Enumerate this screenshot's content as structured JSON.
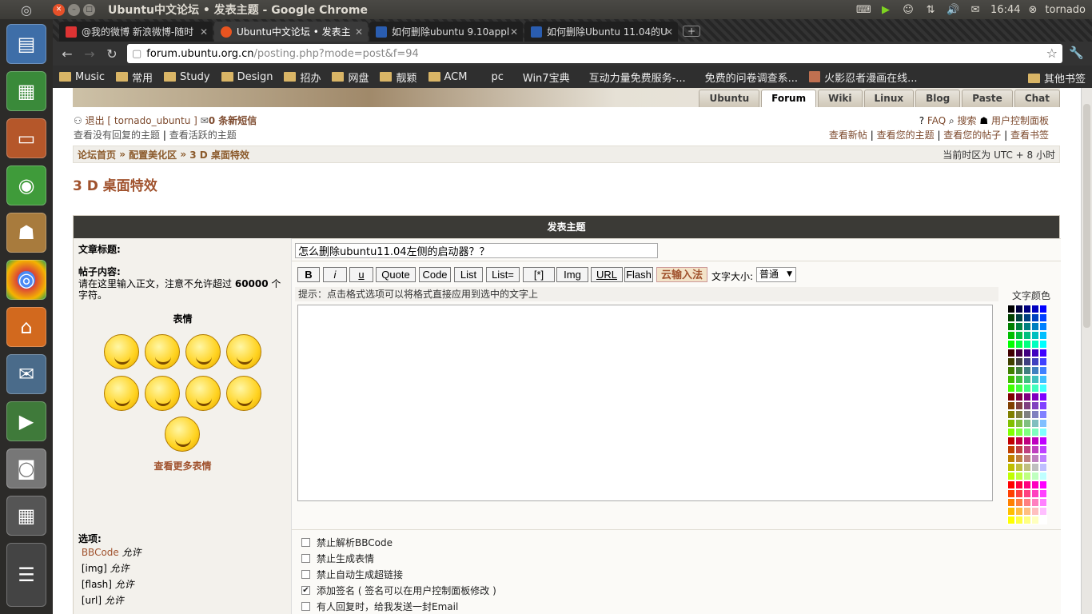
{
  "window": {
    "title": "Ubuntu中文论坛 • 发表主题 - Google Chrome"
  },
  "tray": {
    "time": "16:44",
    "user": "tornado"
  },
  "tabs": [
    {
      "label": "@我的微博 新浪微博-随时",
      "color": "#d33"
    },
    {
      "label": "Ubuntu中文论坛 • 发表主",
      "color": "#e95420"
    },
    {
      "label": "如何删除ubuntu 9.10appl",
      "color": "#2a5db0"
    },
    {
      "label": "如何删除Ubuntu 11.04的U",
      "color": "#2a5db0"
    }
  ],
  "address": {
    "host": "forum.ubuntu.org.cn",
    "path": "/posting.php?mode=post&f=94"
  },
  "bookmarks": [
    "Music",
    "常用",
    "Study",
    "Design",
    "招办",
    "网盘",
    "靓颖",
    "ACM"
  ],
  "bookmarks_plain": [
    "pc",
    "Win7宝典",
    "互动力量免费服务-...",
    "免费的问卷调查系...",
    "火影忍者漫画在线..."
  ],
  "bookmark_other": "其他书签",
  "navtabs": [
    "Ubuntu",
    "Forum",
    "Wiki",
    "Linux",
    "Blog",
    "Paste",
    "Chat"
  ],
  "header": {
    "logout": "退出 [ tornado_ubuntu ]",
    "pm": "0 条新短信",
    "unanswered": "查看没有回复的主题",
    "active": "查看活跃的主题",
    "faq": "FAQ",
    "search": "搜索",
    "ucp": "用户控制面板",
    "newposts": "查看新帖",
    "yourtopics": "查看您的主题",
    "yourposts": "查看您的帖子",
    "bookmarks": "查看书签"
  },
  "breadcrumb": {
    "home": "论坛首页",
    "cat": "配置美化区",
    "forum": "3 D 桌面特效",
    "timezone": "当前时区为 UTC + 8 小时"
  },
  "forum_title": "3 D 桌面特效",
  "form": {
    "head": "发表主题",
    "subject_label": "文章标题:",
    "subject_value": "怎么删除ubuntu11.04左侧的启动器？？",
    "body_label": "帖子内容:",
    "body_note_pre": "请在这里输入正文，注意不允许超过",
    "body_note_num": "60000",
    "body_note_post": "个字符。",
    "smilies_title": "表情",
    "more_smilies": "查看更多表情",
    "buttons": [
      "B",
      "i",
      "u",
      "Quote",
      "Code",
      "List",
      "List=",
      "[*]",
      "Img",
      "URL",
      "Flash",
      "云输入法"
    ],
    "fontsize_label": "文字大小:",
    "fontsize_value": "普通",
    "hint": "提示：点击格式选项可以将格式直接应用到选中的文字上",
    "color_label": "文字颜色",
    "options_label": "选项:",
    "permissions": [
      {
        "name": "BBCode",
        "state": "允许"
      },
      {
        "name": "[img]",
        "state": "允许"
      },
      {
        "name": "[flash]",
        "state": "允许"
      },
      {
        "name": "[url]",
        "state": "允许"
      }
    ],
    "checkboxes": [
      {
        "label": "禁止解析BBCode",
        "checked": false
      },
      {
        "label": "禁止生成表情",
        "checked": false
      },
      {
        "label": "禁止自动生成超链接",
        "checked": false
      },
      {
        "label": "添加签名 ( 签名可以在用户控制面板修改 )",
        "checked": true
      },
      {
        "label": "有人回复时，给我发送一封Email",
        "checked": false
      }
    ]
  }
}
